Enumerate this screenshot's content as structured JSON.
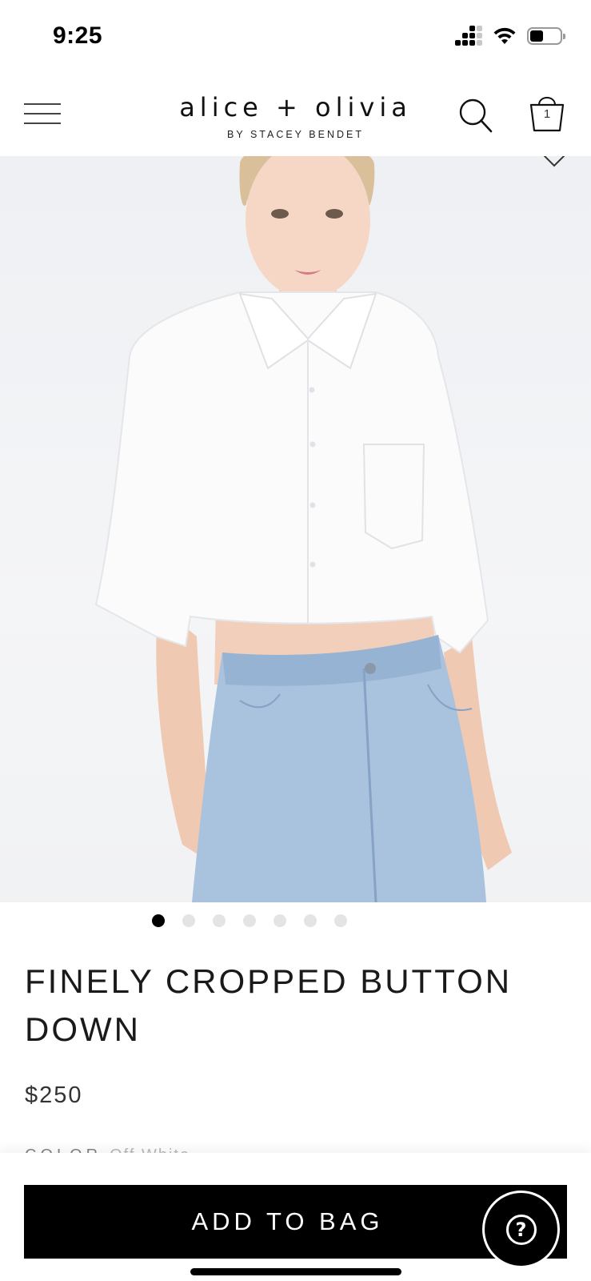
{
  "status_bar": {
    "time": "9:25",
    "battery_level": 0.45
  },
  "header": {
    "logo_main": "alice + olivia",
    "logo_sub": "BY STACEY BENDET",
    "bag_count": "1",
    "icons": [
      "menu-icon",
      "search-icon",
      "bag-icon",
      "heart-icon"
    ]
  },
  "carousel": {
    "total_images": 7,
    "active_index": 0
  },
  "product": {
    "title": "FINELY CROPPED BUTTON DOWN",
    "price": "$250",
    "color_label": "COLOR",
    "color_value": "Off White"
  },
  "actions": {
    "add_to_bag_label": "ADD TO BAG",
    "help_label": "?"
  },
  "colors": {
    "button_bg": "#000000",
    "button_text": "#ffffff",
    "active_dot": "#000000",
    "inactive_dot": "#e4e4e4"
  }
}
